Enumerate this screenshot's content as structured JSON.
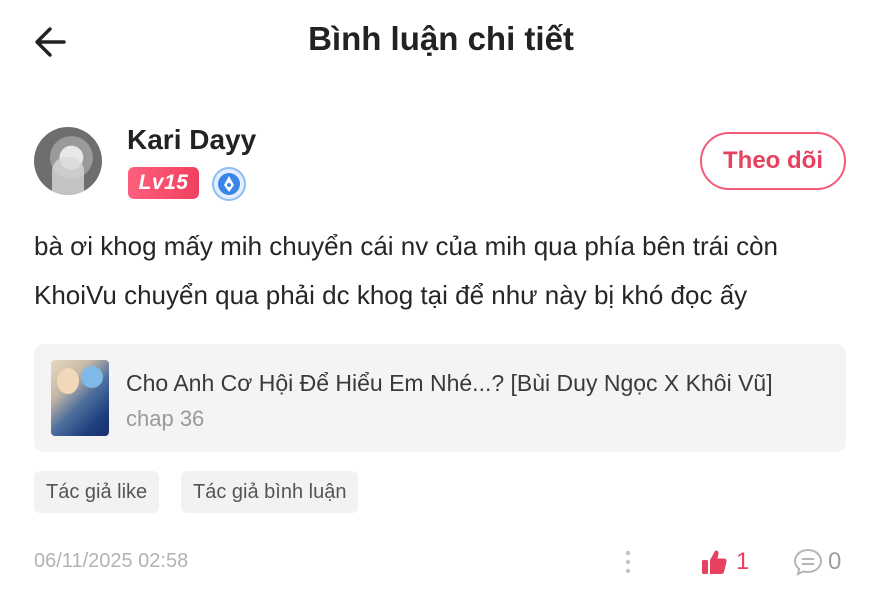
{
  "header": {
    "title": "Bình luận chi tiết"
  },
  "user": {
    "name": "Kari Dayy",
    "level": "Lv15",
    "follow_label": "Theo dõi"
  },
  "comment": {
    "text": "bà ơi khog mấy mih chuyển cái nv của mih qua phía bên trái còn KhoiVu chuyển qua phải dc khog tại để như này bị khó đọc ấy"
  },
  "story": {
    "title": "Cho Anh Cơ Hội Để Hiểu Em Nhé...? [Bùi Duy Ngọc X Khôi Vũ]",
    "chapter": "chap 36"
  },
  "tags": [
    "Tác giả like",
    "Tác giả bình luận"
  ],
  "footer": {
    "timestamp": "06/11/2025 02:58",
    "like_count": "1",
    "reply_count": "0"
  },
  "colors": {
    "accent": "#e8405f",
    "level_badge": "#f0405f",
    "vip_icon": "#3a86e8"
  },
  "icons": {
    "back": "arrow-left-icon",
    "vip": "vip-badge-icon",
    "more": "more-vertical-icon",
    "like": "thumbs-up-icon",
    "reply": "comment-icon"
  }
}
